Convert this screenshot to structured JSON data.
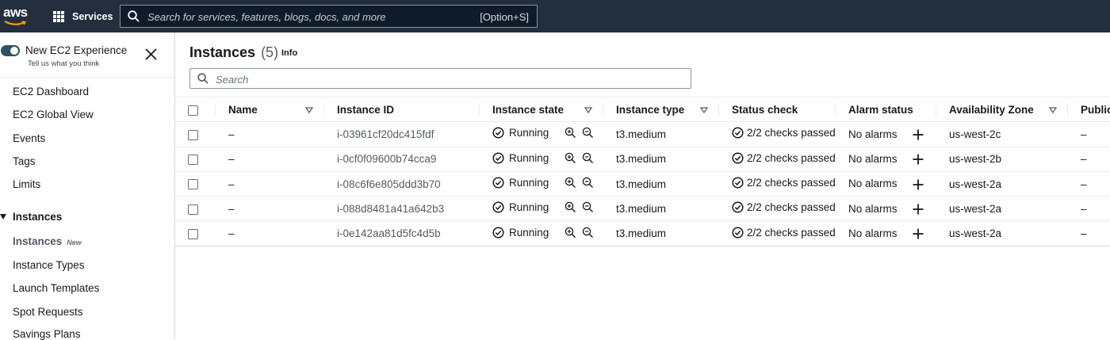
{
  "topbar": {
    "logo_text": "aws",
    "services_label": "Services",
    "search_placeholder": "Search for services, features, blogs, docs, and more",
    "search_shortcut": "[Option+S]"
  },
  "sidebar": {
    "experience_title": "New EC2 Experience",
    "experience_sub": "Tell us what you think",
    "items": [
      {
        "label": "EC2 Dashboard"
      },
      {
        "label": "EC2 Global View"
      },
      {
        "label": "Events"
      },
      {
        "label": "Tags"
      },
      {
        "label": "Limits"
      }
    ],
    "section": "Instances",
    "active_item": "Instances",
    "active_badge": "New",
    "sub_items": [
      {
        "label": "Instance Types"
      },
      {
        "label": "Launch Templates"
      },
      {
        "label": "Spot Requests"
      },
      {
        "label": "Savings Plans"
      }
    ]
  },
  "main": {
    "title": "Instances",
    "count": "(5)",
    "info": "Info",
    "search_placeholder": "Search",
    "columns": [
      "Name",
      "Instance ID",
      "Instance state",
      "Instance type",
      "Status check",
      "Alarm status",
      "Availability Zone",
      "Public"
    ],
    "rows": [
      {
        "name": "–",
        "id": "i-03961cf20dc415fdf",
        "state": "Running",
        "type": "t3.medium",
        "status": "2/2 checks passed",
        "alarm": "No alarms",
        "az": "us-west-2c",
        "public": "–"
      },
      {
        "name": "–",
        "id": "i-0cf0f09600b74cca9",
        "state": "Running",
        "type": "t3.medium",
        "status": "2/2 checks passed",
        "alarm": "No alarms",
        "az": "us-west-2b",
        "public": "–"
      },
      {
        "name": "–",
        "id": "i-08c6f6e805ddd3b70",
        "state": "Running",
        "type": "t3.medium",
        "status": "2/2 checks passed",
        "alarm": "No alarms",
        "az": "us-west-2a",
        "public": "–"
      },
      {
        "name": "–",
        "id": "i-088d8481a41a642b3",
        "state": "Running",
        "type": "t3.medium",
        "status": "2/2 checks passed",
        "alarm": "No alarms",
        "az": "us-west-2a",
        "public": "–"
      },
      {
        "name": "–",
        "id": "i-0e142aa81d5fc4d5b",
        "state": "Running",
        "type": "t3.medium",
        "status": "2/2 checks passed",
        "alarm": "No alarms",
        "az": "us-west-2a",
        "public": "–"
      }
    ]
  }
}
